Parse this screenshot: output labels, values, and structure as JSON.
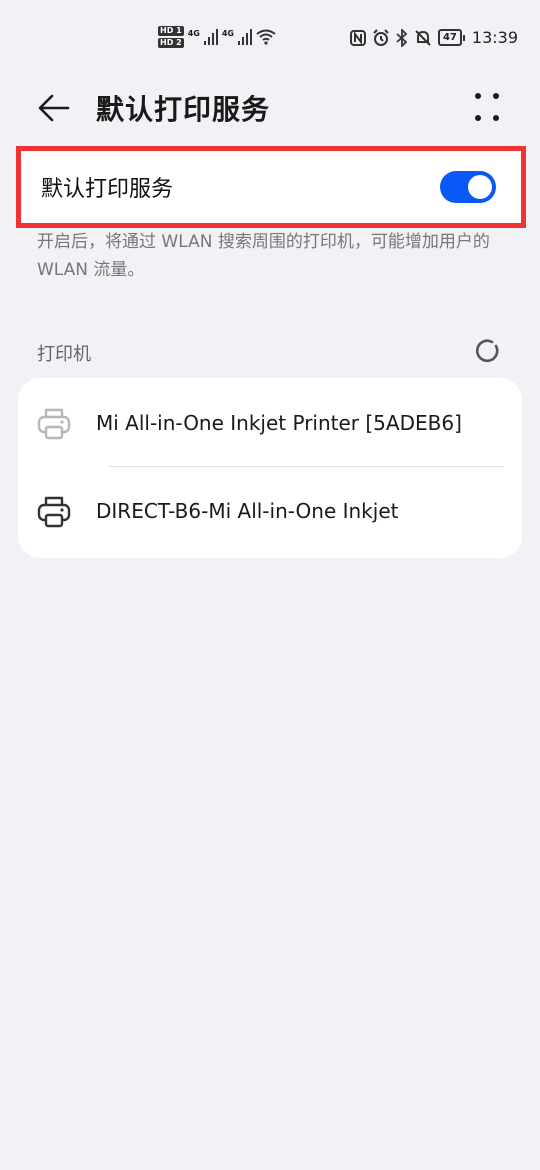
{
  "status_bar": {
    "hd1": "HD 1",
    "hd2": "HD 2",
    "net1": "4G",
    "net2": "4G",
    "battery": "47",
    "time": "13:39",
    "icons": [
      "nfc-icon",
      "alarm-icon",
      "bluetooth-icon",
      "silent-icon",
      "battery-icon",
      "wifi-icon",
      "signal-icon"
    ]
  },
  "header": {
    "title": "默认打印服务",
    "back_icon": "arrow-left",
    "more_icon": "more-vertical-dots"
  },
  "toggle_row": {
    "label": "默认打印服务",
    "enabled": true,
    "accent": "#0a59f7",
    "highlight_color": "#ef3333"
  },
  "description": "开启后，将通过 WLAN 搜索周围的打印机，可能增加用户的 WLAN 流量。",
  "printers_section": {
    "title": "打印机",
    "status_icon": "loading-spinner",
    "items": [
      {
        "label": "Mi All-in-One Inkjet Printer [5ADEB6]",
        "icon": "printer-icon",
        "enabled": false
      },
      {
        "label": "DIRECT-B6-Mi All-in-One Inkjet",
        "icon": "printer-icon",
        "enabled": true
      }
    ]
  }
}
